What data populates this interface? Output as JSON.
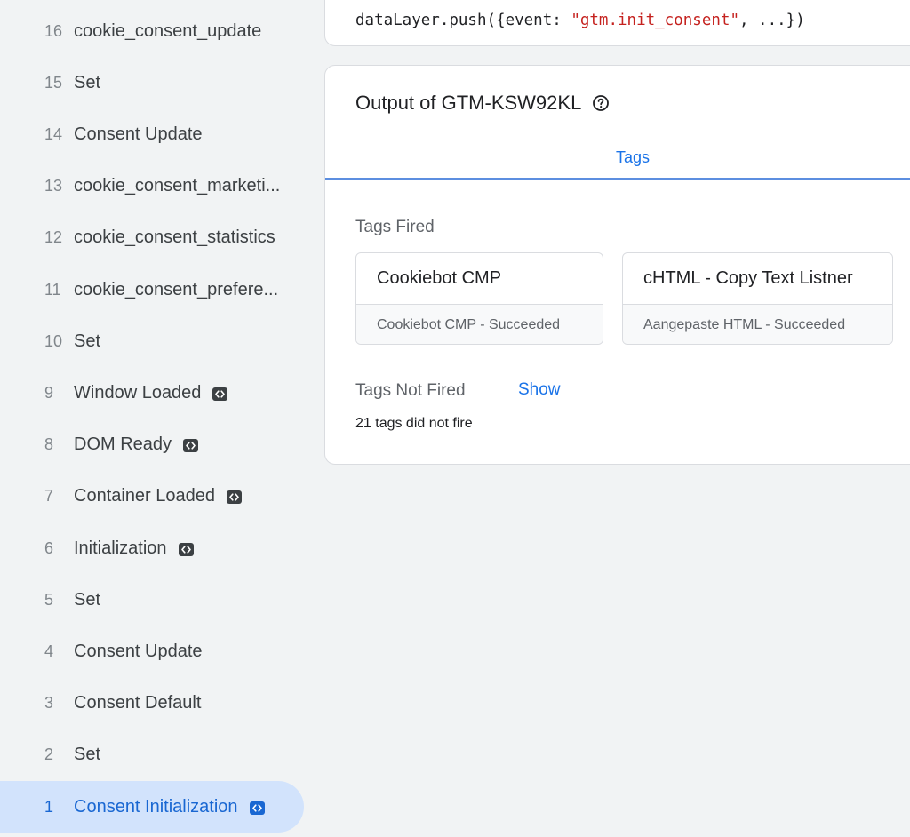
{
  "sidebar": {
    "events": [
      {
        "num": "16",
        "label": "cookie_consent_update",
        "icon": false,
        "selected": false
      },
      {
        "num": "15",
        "label": "Set",
        "icon": false,
        "selected": false
      },
      {
        "num": "14",
        "label": "Consent Update",
        "icon": false,
        "selected": false
      },
      {
        "num": "13",
        "label": "cookie_consent_marketi...",
        "icon": false,
        "selected": false
      },
      {
        "num": "12",
        "label": "cookie_consent_statistics",
        "icon": false,
        "selected": false
      },
      {
        "num": "11",
        "label": "cookie_consent_prefere...",
        "icon": false,
        "selected": false
      },
      {
        "num": "10",
        "label": "Set",
        "icon": false,
        "selected": false
      },
      {
        "num": "9",
        "label": "Window Loaded",
        "icon": true,
        "selected": false
      },
      {
        "num": "8",
        "label": "DOM Ready",
        "icon": true,
        "selected": false
      },
      {
        "num": "7",
        "label": "Container Loaded",
        "icon": true,
        "selected": false
      },
      {
        "num": "6",
        "label": "Initialization",
        "icon": true,
        "selected": false
      },
      {
        "num": "5",
        "label": "Set",
        "icon": false,
        "selected": false
      },
      {
        "num": "4",
        "label": "Consent Update",
        "icon": false,
        "selected": false
      },
      {
        "num": "3",
        "label": "Consent Default",
        "icon": false,
        "selected": false
      },
      {
        "num": "2",
        "label": "Set",
        "icon": false,
        "selected": false
      },
      {
        "num": "1",
        "label": "Consent Initialization",
        "icon": true,
        "selected": true
      }
    ]
  },
  "code": {
    "prefix": "dataLayer.push({event: ",
    "event_string": "\"gtm.init_consent\"",
    "suffix": ", ...})"
  },
  "output": {
    "title": "Output of GTM-KSW92KL",
    "help_icon": "help-circle-icon",
    "tab_label": "Tags",
    "tags_fired_heading": "Tags Fired",
    "tags_fired": [
      {
        "name": "Cookiebot CMP",
        "status": "Cookiebot CMP - Succeeded"
      },
      {
        "name": "cHTML - Copy Text Listner",
        "status": "Aangepaste HTML - Succeeded"
      }
    ],
    "tags_not_fired_heading": "Tags Not Fired",
    "show_label": "Show",
    "not_fired_count_text": "21 tags did not fire"
  },
  "colors": {
    "accent": "#1a73e8",
    "selected_bg": "#d2e3fc",
    "string_red": "#c5221f",
    "page_bg": "#f1f3f4"
  }
}
